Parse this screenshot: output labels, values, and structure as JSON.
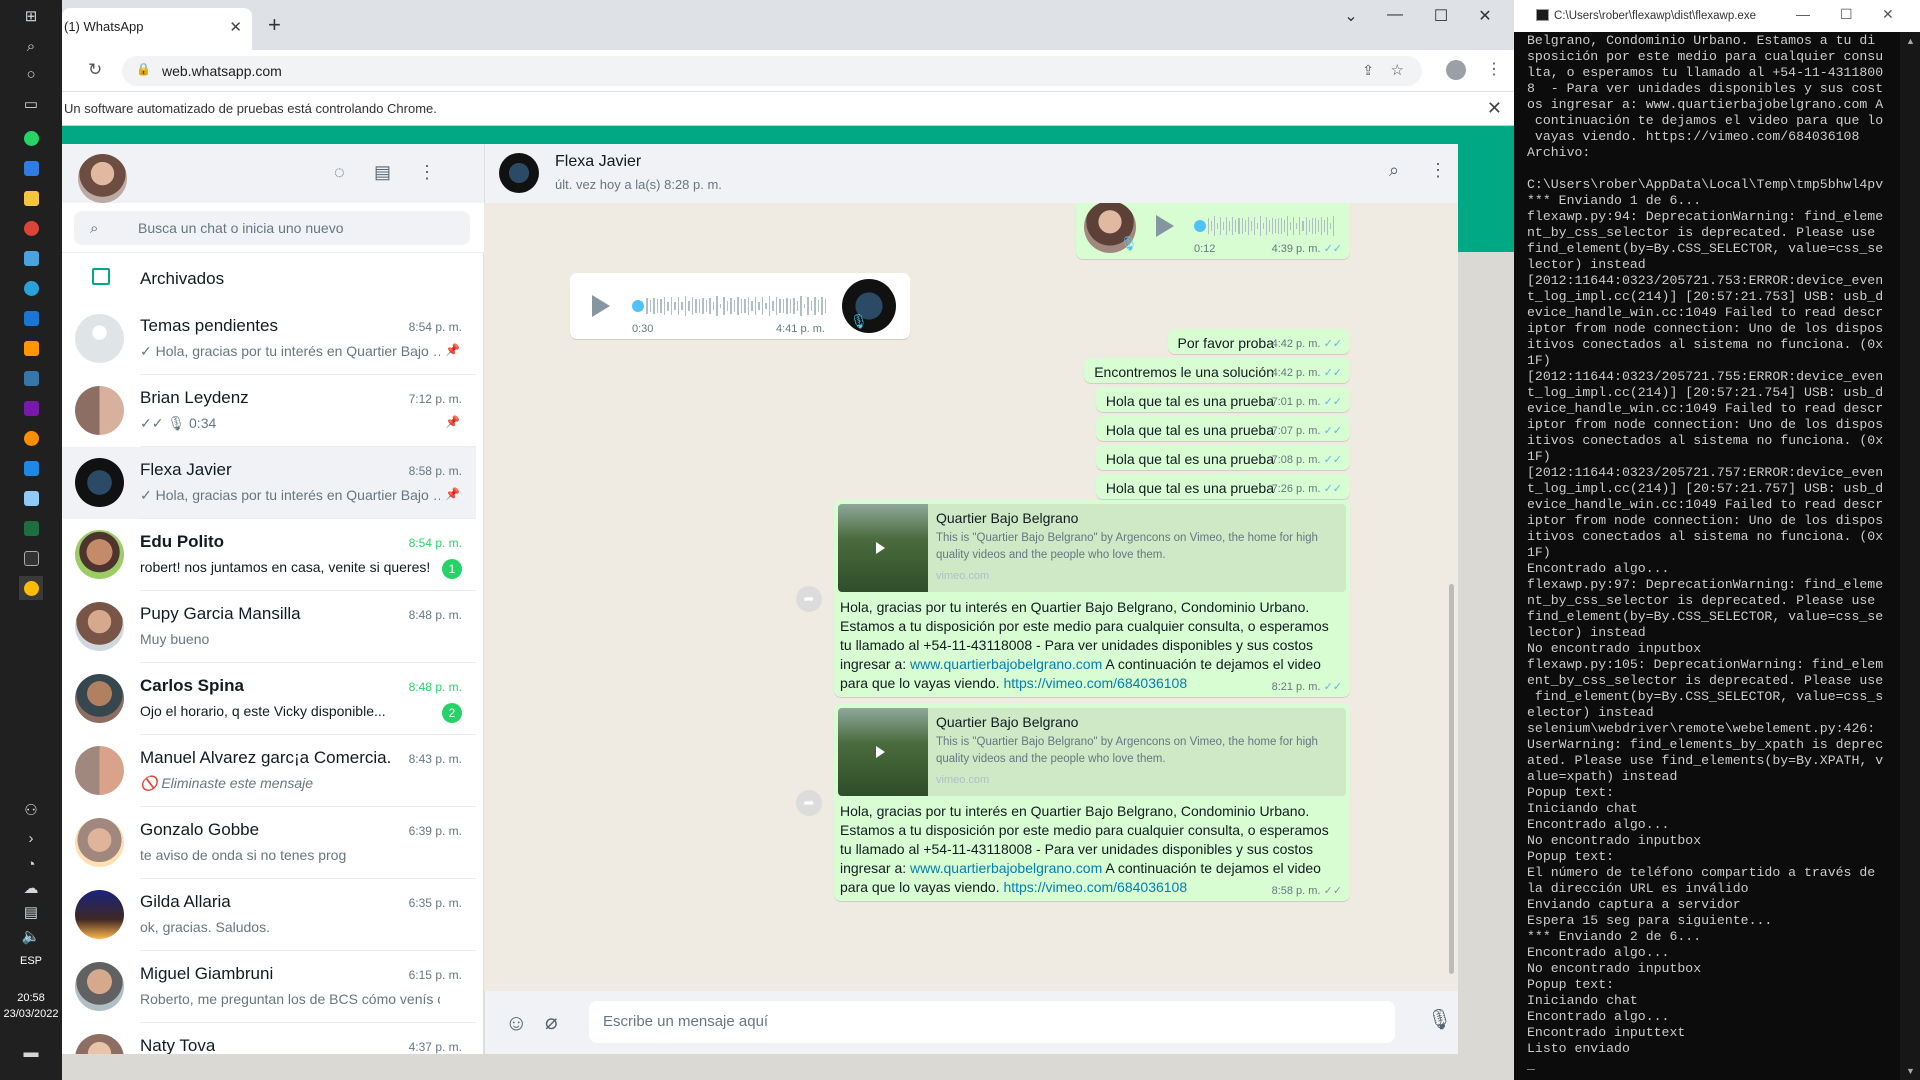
{
  "taskbar": {
    "lang": "ESP",
    "time": "20:58",
    "date": "23/03/2022"
  },
  "chrome": {
    "tab_title": "(1) WhatsApp",
    "url": "web.whatsapp.com",
    "infobar_text": "Un software automatizado de pruebas está controlando Chrome."
  },
  "whatsapp": {
    "left": {
      "search_placeholder": "Busca un chat o inicia uno nuevo",
      "archived_label": "Archivados",
      "chats": [
        {
          "name": "Temas pendientes",
          "time": "8:54 p. m.",
          "preview": "✓ Hola, gracias por tu interés en Quartier Bajo …",
          "pinned": true,
          "unread": "",
          "bold": false,
          "avatar": "group"
        },
        {
          "name": "Brian Leydenz",
          "time": "7:12 p. m.",
          "preview": "✓✓ 🎙 0:34",
          "pinned": true,
          "unread": "",
          "bold": false,
          "avatar": "couple"
        },
        {
          "name": "Flexa Javier",
          "time": "8:58 p. m.",
          "preview": "✓ Hola, gracias por tu interés en Quartier Bajo …",
          "pinned": true,
          "unread": "",
          "bold": false,
          "avatar": "flexa"
        },
        {
          "name": "Edu Polito",
          "time": "8:54 p. m.",
          "preview": "robert! nos juntamos en casa, venite si queres!",
          "pinned": false,
          "unread": "1",
          "bold": true,
          "avatar": "man"
        },
        {
          "name": "Pupy Garcia Mansilla",
          "time": "8:48 p. m.",
          "preview": "Muy bueno",
          "pinned": false,
          "unread": "",
          "bold": false,
          "avatar": "woman"
        },
        {
          "name": "Carlos Spina",
          "time": "8:48 p. m.",
          "preview": "Ojo el horario, q este Vicky disponible...",
          "pinned": false,
          "unread": "2",
          "bold": true,
          "avatar": "man2"
        },
        {
          "name": "Manuel Alvarez garc¡a Comercia...",
          "time": "8:43 p. m.",
          "preview": "🚫 Eliminaste este mensaje",
          "pinned": false,
          "unread": "",
          "bold": false,
          "italic": true,
          "avatar": "couple2"
        },
        {
          "name": "Gonzalo Gobbe",
          "time": "6:39 p. m.",
          "preview": "te aviso de onda si no tenes prog",
          "pinned": false,
          "unread": "",
          "bold": false,
          "avatar": "kid"
        },
        {
          "name": "Gilda Allaria",
          "time": "6:35 p. m.",
          "preview": "ok, gracias. Saludos.",
          "pinned": false,
          "unread": "",
          "bold": false,
          "avatar": "night"
        },
        {
          "name": "Miguel Giambruni",
          "time": "6:15 p. m.",
          "preview": "Roberto, me preguntan los de BCS cómo venís c...",
          "pinned": false,
          "unread": "",
          "bold": false,
          "avatar": "man3"
        },
        {
          "name": "Naty Tova",
          "time": "4:37 p. m.",
          "preview": "",
          "pinned": false,
          "unread": "",
          "bold": false,
          "avatar": "woman2"
        }
      ]
    },
    "contact": {
      "name": "Flexa Javier",
      "status": "últ. vez hoy a la(s) 8:28 p. m."
    },
    "audio_out": {
      "duration": "0:12",
      "time": "4:39 p. m."
    },
    "audio_in": {
      "duration": "0:30",
      "time": "4:41 p. m."
    },
    "messages": [
      {
        "text": "Por favor proba",
        "time": "4:42 p. m."
      },
      {
        "text": "Encontremos le una solución",
        "time": "4:42 p. m."
      },
      {
        "text": "Hola que tal es una prueba",
        "time": "7:01 p. m."
      },
      {
        "text": "Hola que tal es una prueba",
        "time": "7:07 p. m."
      },
      {
        "text": "Hola que tal es una prueba",
        "time": "7:08 p. m."
      },
      {
        "text": "Hola que tal es una prueba",
        "time": "7:26 p. m."
      }
    ],
    "link_messages": [
      {
        "preview_title": "Quartier Bajo Belgrano",
        "preview_desc": "This is \"Quartier Bajo Belgrano\" by Argencons on Vimeo, the home for high quality videos and the people who love them.",
        "preview_url": "vimeo.com",
        "body_pre": "Hola, gracias por tu interés en Quartier Bajo Belgrano, Condominio Urbano. Estamos a tu disposición por este medio para cualquier consulta, o esperamos tu llamado al +54-11-43118008  - Para ver unidades disponibles y sus costos ingresar a: ",
        "link1": "www.quartierbajobelgrano.com",
        "body_mid": " A continuación te dejamos el video para que lo vayas viendo. ",
        "link2": "https://vimeo.com/684036108",
        "time": "8:21 p. m."
      },
      {
        "preview_title": "Quartier Bajo Belgrano",
        "preview_desc": "This is \"Quartier Bajo Belgrano\" by Argencons on Vimeo, the home for high quality videos and the people who love them.",
        "preview_url": "vimeo.com",
        "body_pre": "Hola, gracias por tu interés en Quartier Bajo Belgrano, Condominio Urbano. Estamos a tu disposición por este medio para cualquier consulta, o esperamos tu llamado al +54-11-43118008  - Para ver unidades disponibles y sus costos ingresar a: ",
        "link1": "www.quartierbajobelgrano.com",
        "body_mid": " A continuación te dejamos el video para que lo vayas viendo. ",
        "link2": "https://vimeo.com/684036108",
        "time": "8:58 p. m."
      }
    ],
    "composer_placeholder": "Escribe un mensaje aquí"
  },
  "console": {
    "title": "C:\\Users\\rober\\flexawp\\dist\\flexawp.exe",
    "lines": "Belgrano, Condominio Urbano. Estamos a tu di\nsposición por este medio para cualquier consu\nlta, o esperamos tu llamado al +54-11-4311800\n8  - Para ver unidades disponibles y sus cost\nos ingresar a: www.quartierbajobelgrano.com A\n continuación te dejamos el video para que lo\n vayas viendo. https://vimeo.com/684036108\nArchivo:\n\nC:\\Users\\rober\\AppData\\Local\\Temp\\tmp5bhwl4pv\n*** Enviando 1 de 6...\nflexawp.py:94: DeprecationWarning: find_eleme\nnt_by_css_selector is deprecated. Please use\nfind_element(by=By.CSS_SELECTOR, value=css_se\nlector) instead\n[2012:11644:0323/205721.753:ERROR:device_even\nt_log_impl.cc(214)] [20:57:21.753] USB: usb_d\nevice_handle_win.cc:1049 Failed to read descr\niptor from node connection: Uno de los dispos\nitivos conectados al sistema no funciona. (0x\n1F)\n[2012:11644:0323/205721.755:ERROR:device_even\nt_log_impl.cc(214)] [20:57:21.754] USB: usb_d\nevice_handle_win.cc:1049 Failed to read descr\niptor from node connection: Uno de los dispos\nitivos conectados al sistema no funciona. (0x\n1F)\n[2012:11644:0323/205721.757:ERROR:device_even\nt_log_impl.cc(214)] [20:57:21.757] USB: usb_d\nevice_handle_win.cc:1049 Failed to read descr\niptor from node connection: Uno de los dispos\nitivos conectados al sistema no funciona. (0x\n1F)\nEncontrado algo...\nflexawp.py:97: DeprecationWarning: find_eleme\nnt_by_css_selector is deprecated. Please use\nfind_element(by=By.CSS_SELECTOR, value=css_se\nlector) instead\nNo encontrado inputbox\nflexawp.py:105: DeprecationWarning: find_elem\nent_by_css_selector is deprecated. Please use\n find_element(by=By.CSS_SELECTOR, value=css_s\nelector) instead\nselenium\\webdriver\\remote\\webelement.py:426:\nUserWarning: find_elements_by_xpath is deprec\nated. Please use find_elements(by=By.XPATH, v\nalue=xpath) instead\nPopup text:\nIniciando chat\nEncontrado algo...\nNo encontrado inputbox\nPopup text:\nEl número de teléfono compartido a través de\nla dirección URL es inválido\nEnviando captura a servidor\nEspera 15 seg para siguiente...\n*** Enviando 2 de 6...\nEncontrado algo...\nNo encontrado inputbox\nPopup text:\nIniciando chat\nEncontrado algo...\nEncontrado inputtext\nListo enviado\n_"
  }
}
